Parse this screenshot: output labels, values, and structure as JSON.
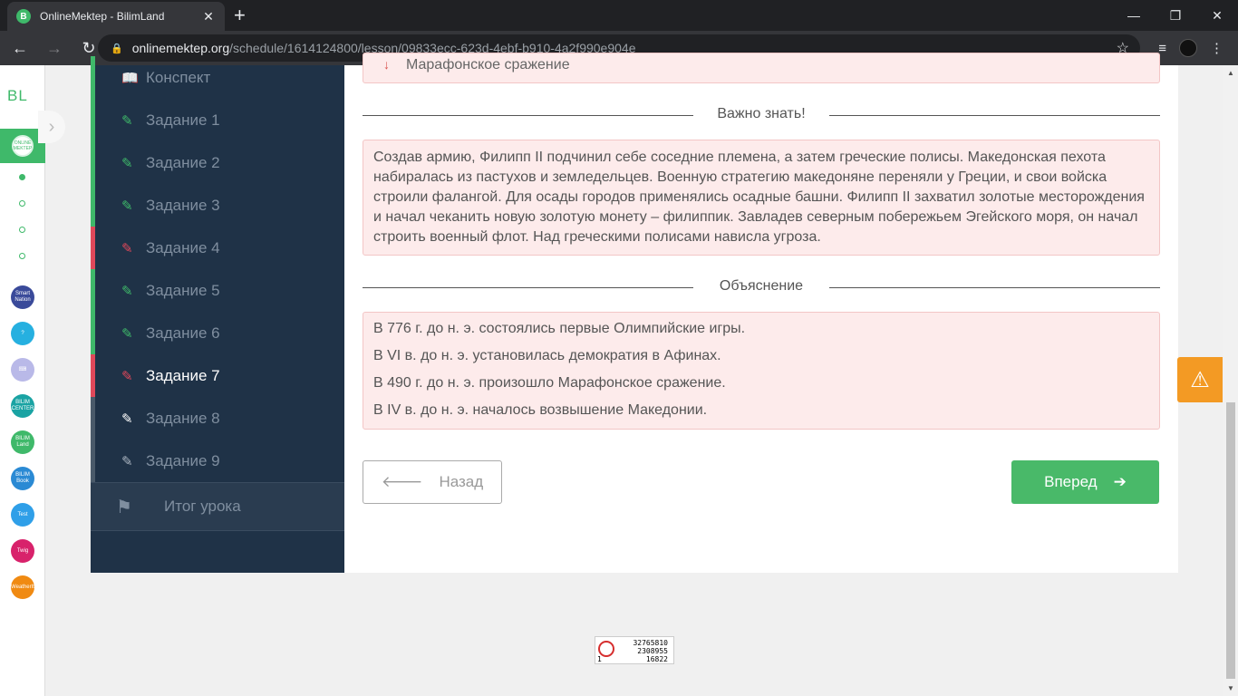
{
  "browser": {
    "tab_title": "OnlineMektep - BilimLand",
    "tab_favicon": "B",
    "new_tab": "+",
    "url_host": "onlinemektep.org",
    "url_path": "/schedule/1614124800/lesson/09833ecc-623d-4ebf-b910-4a2f990e904e"
  },
  "rail": {
    "logo": "BL",
    "active_app": "ONLINE MEKTEP",
    "apps": [
      {
        "name": "smart-nation-icon",
        "label": "Smart Nation",
        "color": "#3a4a9a"
      },
      {
        "name": "help-icon",
        "label": "?",
        "color": "#26b0e0"
      },
      {
        "name": "keyboard-icon",
        "label": "⌨",
        "color": "#b9b9e8"
      },
      {
        "name": "bilim-center-icon",
        "label": "BILIM CENTER",
        "color": "#1aa3a3"
      },
      {
        "name": "bilimland-icon",
        "label": "BILIM Land",
        "color": "#3fb96a"
      },
      {
        "name": "bilimbook-icon",
        "label": "BILIM Book",
        "color": "#2a8ad4"
      },
      {
        "name": "test-icon",
        "label": "Test",
        "color": "#2f9fe8"
      },
      {
        "name": "twig-icon",
        "label": "Twig",
        "color": "#d8226b"
      },
      {
        "name": "weather-icon",
        "label": "WeatherIt",
        "color": "#f08a12"
      }
    ]
  },
  "lesson_nav": {
    "items": [
      {
        "label": "Конспект",
        "status": "neutral"
      },
      {
        "label": "Задание 1",
        "status": "correct"
      },
      {
        "label": "Задание 2",
        "status": "correct"
      },
      {
        "label": "Задание 3",
        "status": "correct"
      },
      {
        "label": "Задание 4",
        "status": "wrong"
      },
      {
        "label": "Задание 5",
        "status": "correct"
      },
      {
        "label": "Задание 6",
        "status": "correct"
      },
      {
        "label": "Задание 7",
        "status": "wrong"
      },
      {
        "label": "Задание 8",
        "status": "pending"
      },
      {
        "label": "Задание 9",
        "status": "pending"
      }
    ],
    "summary": "Итог урока"
  },
  "content": {
    "top_answer": "Марафонское сражение",
    "important_title": "Важно знать!",
    "important_text": "Создав армию, Филипп II подчинил себе соседние племена, а затем греческие полисы. Македонская пехота набиралась из пастухов и земледельцев. Военную стратегию македоняне переняли у Греции, и свои войска строили фалангой. Для осады городов применялись осадные башни. Филипп II захватил золотые месторождения и начал чеканить новую золотую монету – филиппик. Завладев северным побережьем Эгейского моря, он начал строить военный флот. Над греческими полисами нависла угроза.",
    "explanation_title": "Объяснение",
    "explanation_items": [
      "В 776 г. до н. э. состоялись первые Олимпийские игры.",
      "В VI в. до н. э. установилась демократия в Афинах.",
      "В 490 г. до н. э. произошло Марафонское сражение.",
      "В IV в. до н. э. началось возвышение Македонии."
    ],
    "back_label": "Назад",
    "next_label": "Вперед"
  },
  "counter": {
    "line1": "32765810",
    "line2": "2308955",
    "line3": "16822",
    "line0": "1"
  },
  "colors": {
    "correct": "#3fb96a",
    "wrong": "#e0485a",
    "pending": "#4a5a6a",
    "accent": "#49b969",
    "warn": "#f39a24"
  }
}
